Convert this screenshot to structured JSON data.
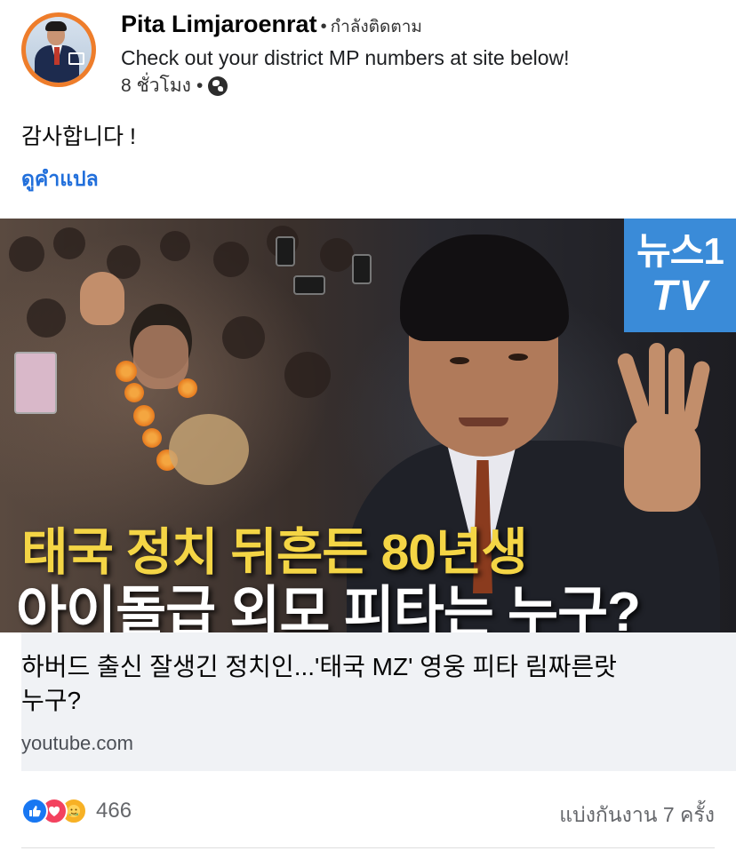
{
  "post": {
    "author": "Pita Limjaroenrat",
    "follow_label": "กำลังติดตาม",
    "subtitle": "Check out your district MP numbers at site below!",
    "time": "8 ชั่วโมง",
    "privacy_icon": "globe-icon",
    "text": "감사합니다 !",
    "translate_label": "ดูคำแปล"
  },
  "media": {
    "logo_line1": "뉴스1",
    "logo_line2": "TV",
    "headline_1": "태국 정치 뒤흔든 80년생",
    "headline_2": "아이돌급 외모 피타는 누구?",
    "colors": {
      "logo_bg": "#3a8bd8",
      "headline_1": "#f4d545",
      "headline_2": "#ffffff"
    }
  },
  "link": {
    "title": "하버드 출신 잘생긴 정치인...'태국 MZ' 영웅 피타 림짜른랏 누구?",
    "domain": "youtube.com"
  },
  "footer": {
    "reaction_icons": [
      "like-icon",
      "love-icon",
      "care-icon"
    ],
    "reaction_count": "466",
    "shares": "แบ่งกันงาน 7 ครั้ง"
  },
  "colors": {
    "accent": "#216fdb",
    "card_bg": "#f0f2f5"
  }
}
